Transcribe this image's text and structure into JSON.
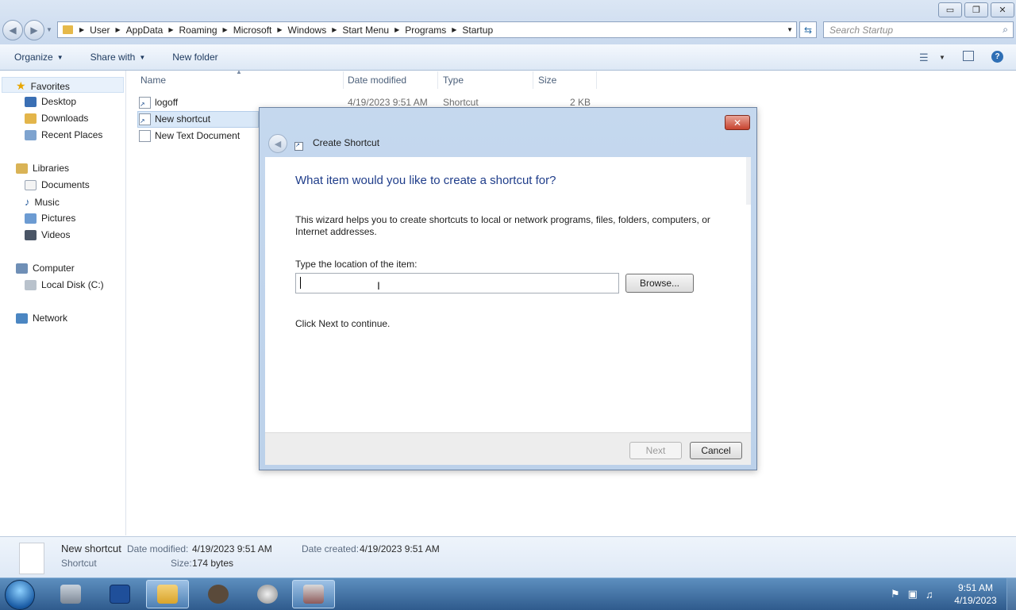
{
  "window": {
    "minimize_glyph": "▭",
    "restore_glyph": "❐",
    "close_glyph": "✕"
  },
  "address": {
    "crumbs": [
      "User",
      "AppData",
      "Roaming",
      "Microsoft",
      "Windows",
      "Start Menu",
      "Programs",
      "Startup"
    ]
  },
  "search": {
    "placeholder": "Search Startup"
  },
  "toolbar": {
    "organize": "Organize",
    "share_with": "Share with",
    "new_folder": "New folder"
  },
  "nav": {
    "favorites": "Favorites",
    "desktop": "Desktop",
    "downloads": "Downloads",
    "recent_places": "Recent Places",
    "libraries": "Libraries",
    "documents": "Documents",
    "music": "Music",
    "pictures": "Pictures",
    "videos": "Videos",
    "computer": "Computer",
    "local_disk": "Local Disk (C:)",
    "network": "Network"
  },
  "columns": {
    "name": "Name",
    "date_modified": "Date modified",
    "type": "Type",
    "size": "Size"
  },
  "files": [
    {
      "name": "logoff",
      "date": "4/19/2023 9:51 AM",
      "type": "Shortcut",
      "size": "2 KB"
    },
    {
      "name": "New shortcut",
      "date": "",
      "type": "",
      "size": ""
    },
    {
      "name": "New Text Document",
      "date": "",
      "type": "",
      "size": ""
    }
  ],
  "dialog": {
    "title": "Create Shortcut",
    "close_glyph": "✕",
    "heading": "What item would you like to create a shortcut for?",
    "description": "This wizard helps you to create shortcuts to local or network programs, files, folders, computers, or Internet addresses.",
    "location_label": "Type the location of the item:",
    "location_value": "",
    "browse": "Browse...",
    "next_hint": "Click Next to continue.",
    "next": "Next",
    "cancel": "Cancel"
  },
  "details": {
    "name": "New shortcut",
    "type": "Shortcut",
    "date_modified_label": "Date modified:",
    "date_modified": "4/19/2023 9:51 AM",
    "date_created_label": "Date created:",
    "date_created": "4/19/2023 9:51 AM",
    "size_label": "Size:",
    "size": "174 bytes"
  },
  "taskbar": {
    "time": "9:51 AM",
    "date": "4/19/2023"
  },
  "colors": {
    "accent_blue": "#1f3d8a",
    "taskbar": "#2f5b8d",
    "dialog_frame": "#bcd1ea"
  }
}
